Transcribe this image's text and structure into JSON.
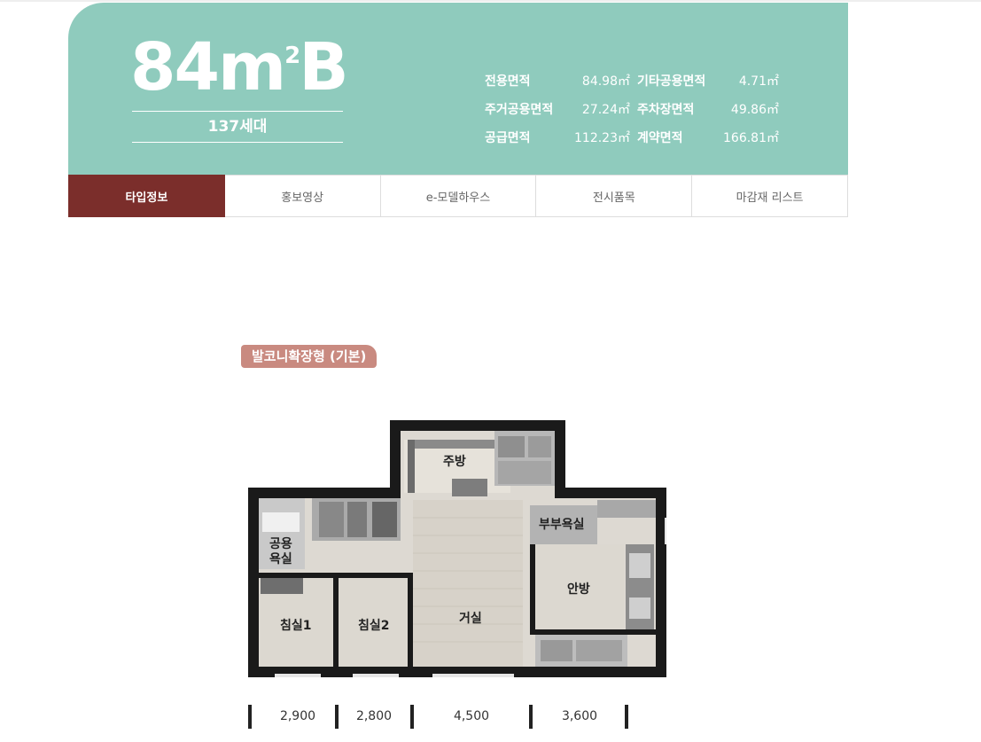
{
  "hero": {
    "type_main": "84m",
    "type_sup": "2",
    "type_suffix": "B",
    "units": "137세대",
    "areas": [
      [
        {
          "label": "전용면적",
          "value": "84.98㎡"
        },
        {
          "label": "기타공용면적",
          "value": "4.71㎡"
        }
      ],
      [
        {
          "label": "주거공용면적",
          "value": "27.24㎡"
        },
        {
          "label": "주차장면적",
          "value": "49.86㎡"
        }
      ],
      [
        {
          "label": "공급면적",
          "value": "112.23㎡"
        },
        {
          "label": "계약면적",
          "value": "166.81㎡"
        }
      ]
    ]
  },
  "tabs": [
    "타입정보",
    "홍보영상",
    "e-모델하우스",
    "전시품목",
    "마감재 리스트"
  ],
  "plan": {
    "badge": "발코니확장형 (기본)",
    "rooms": {
      "kitchen": "주방",
      "master_bath": "부부욕실",
      "common_bath_1": "공용",
      "common_bath_2": "욕실",
      "master_bedroom": "안방",
      "bedroom1": "침실1",
      "bedroom2": "침실2",
      "living": "거실"
    },
    "dimensions": [
      "2,900",
      "2,800",
      "4,500",
      "3,600"
    ]
  },
  "colors": {
    "hero_bg": "#8fcbbd",
    "tab_active": "#7b2e2b",
    "badge_bg": "#c98a80"
  }
}
